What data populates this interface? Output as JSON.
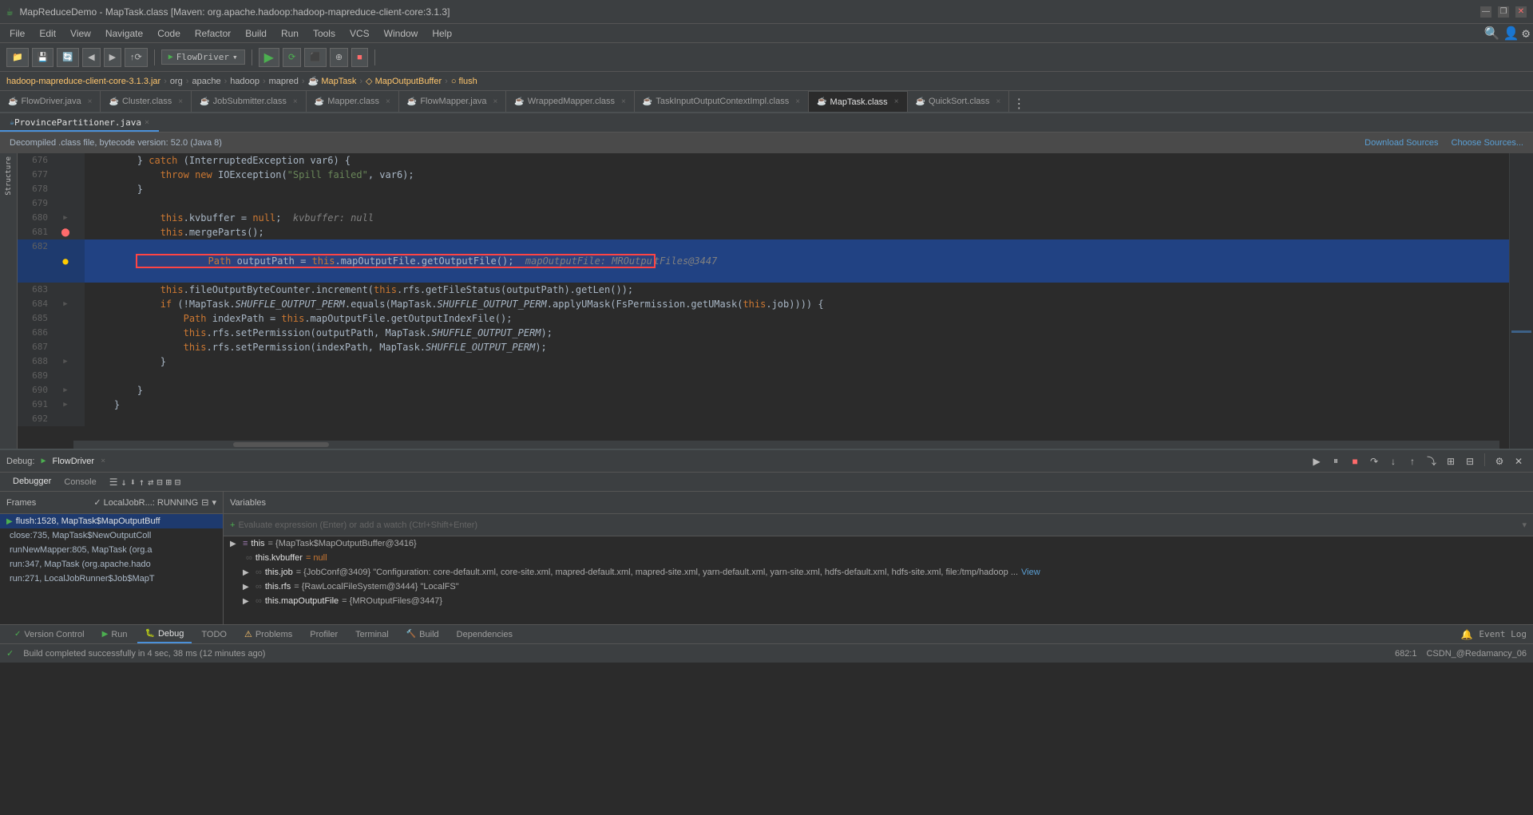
{
  "titleBar": {
    "title": "MapReduceDemo - MapTask.class [Maven: org.apache.hadoop:hadoop-mapreduce-client-core:3.1.3]",
    "minBtn": "—",
    "maxBtn": "❐",
    "closeBtn": "✕"
  },
  "menuBar": {
    "items": [
      "File",
      "Edit",
      "View",
      "Navigate",
      "Code",
      "Refactor",
      "Build",
      "Run",
      "Tools",
      "VCS",
      "Window",
      "Help"
    ]
  },
  "toolbar": {
    "flowDriverLabel": "FlowDriver",
    "dropdownArrow": "▾"
  },
  "breadcrumb": {
    "items": [
      "hadoop-mapreduce-client-core-3.1.3.jar",
      "org",
      "apache",
      "hadoop",
      "mapred",
      "MapTask",
      "MapOutputBuffer",
      "flush"
    ]
  },
  "tabs": [
    {
      "id": "flowdriver",
      "label": "FlowDriver.java",
      "active": false,
      "icon": "java-blue"
    },
    {
      "id": "cluster",
      "label": "Cluster.class",
      "active": false,
      "icon": "java-orange"
    },
    {
      "id": "jobsubmitter",
      "label": "JobSubmitter.class",
      "active": false,
      "icon": "java-orange"
    },
    {
      "id": "mapper",
      "label": "Mapper.class",
      "active": false,
      "icon": "java-orange"
    },
    {
      "id": "flowmapper",
      "label": "FlowMapper.java",
      "active": false,
      "icon": "java-blue"
    },
    {
      "id": "wrappedmapper",
      "label": "WrappedMapper.class",
      "active": false,
      "icon": "java-orange"
    },
    {
      "id": "taskinput",
      "label": "TaskInputOutputContextImpl.class",
      "active": false,
      "icon": "java-orange"
    },
    {
      "id": "maptask",
      "label": "MapTask.class",
      "active": true,
      "icon": "java-orange"
    },
    {
      "id": "quicksort",
      "label": "QuickSort.class",
      "active": false,
      "icon": "java-orange"
    }
  ],
  "subTabs": [
    {
      "label": "ProvincePartitioner.java",
      "active": true
    }
  ],
  "decompileNotice": {
    "text": "Decompiled .class file, bytecode version: 52.0 (Java 8)",
    "downloadSources": "Download Sources",
    "chooseSources": "Choose Sources..."
  },
  "codeLines": [
    {
      "num": 676,
      "content": "        } catch (InterruptedException var6) {",
      "indent": 0,
      "type": "normal"
    },
    {
      "num": 677,
      "content": "            throw new IOException(\"Spill failed\", var6);",
      "indent": 0,
      "type": "normal"
    },
    {
      "num": 678,
      "content": "        }",
      "indent": 0,
      "type": "normal"
    },
    {
      "num": 679,
      "content": "",
      "indent": 0,
      "type": "normal"
    },
    {
      "num": 680,
      "content": "            this.kvbuffer = null;  kvbuffer: null",
      "indent": 0,
      "type": "normal",
      "gutter": "fold"
    },
    {
      "num": 681,
      "content": "            this.mergeParts();",
      "indent": 0,
      "type": "breakpoint"
    },
    {
      "num": 682,
      "content": "            Path outputPath = this.mapOutputFile.getOutputFile();  mapOutputFile: MROutpu",
      "indent": 0,
      "type": "highlight",
      "gutter": "bullet"
    },
    {
      "num": 683,
      "content": "            this.fileOutputByteCounter.increment(this.rfs.getFileStatus(outputPath).getLen());",
      "indent": 0,
      "type": "normal"
    },
    {
      "num": 684,
      "content": "            if (!MapTask.SHUFFLE_OUTPUT_PERM.equals(MapTask.SHUFFLE_OUTPUT_PERM.applyUMask(FsPermission.getUMask(this.job)))) {",
      "indent": 0,
      "type": "normal",
      "gutter": "fold"
    },
    {
      "num": 685,
      "content": "                Path indexPath = this.mapOutputFile.getOutputIndexFile();",
      "indent": 0,
      "type": "normal"
    },
    {
      "num": 686,
      "content": "                this.rfs.setPermission(outputPath, MapTask.SHUFFLE_OUTPUT_PERM);",
      "indent": 0,
      "type": "normal"
    },
    {
      "num": 687,
      "content": "                this.rfs.setPermission(indexPath, MapTask.SHUFFLE_OUTPUT_PERM);",
      "indent": 0,
      "type": "normal"
    },
    {
      "num": 688,
      "content": "            }",
      "indent": 0,
      "type": "normal",
      "gutter": "fold"
    },
    {
      "num": 689,
      "content": "",
      "indent": 0,
      "type": "normal"
    },
    {
      "num": 690,
      "content": "        }",
      "indent": 0,
      "type": "normal",
      "gutter": "fold"
    },
    {
      "num": 691,
      "content": "    }",
      "indent": 0,
      "type": "normal",
      "gutter": "fold"
    },
    {
      "num": 692,
      "content": "",
      "indent": 0,
      "type": "normal"
    }
  ],
  "debugPanel": {
    "title": "Debug:",
    "flowDriverTab": "FlowDriver",
    "tabs": [
      "Debugger",
      "Console"
    ],
    "activeTab": "Debugger",
    "framesLabel": "Frames",
    "variablesLabel": "Variables",
    "frameFilter": "LocalJobR...: RUNNING",
    "frames": [
      {
        "id": 1,
        "text": "flush:1528, MapTask$MapOutputBuff",
        "type": "active",
        "icon": "green"
      },
      {
        "id": 2,
        "text": "close:735, MapTask$NewOutputColl",
        "type": "normal"
      },
      {
        "id": 3,
        "text": "runNewMapper:805, MapTask (org.a",
        "type": "normal"
      },
      {
        "id": 4,
        "text": "run:347, MapTask (org.apache.hado",
        "type": "normal"
      },
      {
        "id": 5,
        "text": "run:271, LocalJobRunner$Job$MapT",
        "type": "normal"
      }
    ],
    "watchPlaceholder": "Evaluate expression (Enter) or add a watch (Ctrl+Shift+Enter)",
    "variables": [
      {
        "key": "this",
        "val": "{MapTask$MapOutputBuffer@3416}",
        "expand": true,
        "indent": 0
      },
      {
        "key": "this.kvbuffer",
        "val": "= null",
        "indent": 1,
        "sub": true
      },
      {
        "key": "this.job",
        "val": "= {JobConf@3409} \"Configuration: core-default.xml, core-site.xml, mapred-default.xml, mapred-site.xml, yarn-default.xml, yarn-site.xml, hdfs-default.xml, hdfs-site.xml, file:/tmp/hadoop ... View",
        "expand": true,
        "indent": 1
      },
      {
        "key": "this.rfs",
        "val": "= {RawLocalFileSystem@3444} \"LocalFS\"",
        "expand": true,
        "indent": 1
      },
      {
        "key": "this.mapOutputFile",
        "val": "= {MROutputFiles@3447}",
        "expand": true,
        "indent": 1
      }
    ]
  },
  "bottomTabs": [
    {
      "label": "Version Control",
      "icon": "vc"
    },
    {
      "label": "▶ Run"
    },
    {
      "label": "🐛 Debug",
      "active": true
    },
    {
      "label": "TODO"
    },
    {
      "label": "⚠ Problems"
    },
    {
      "label": "Profiler"
    },
    {
      "label": "Terminal"
    },
    {
      "label": "🔨 Build"
    },
    {
      "label": "Dependencies"
    }
  ],
  "statusBar": {
    "left": "Build completed successfully in 4 sec, 38 ms (12 minutes ago)",
    "right": "682:1",
    "branch": "CSDN_@Redamancy_06",
    "eventLog": "🔔 Event Log"
  }
}
